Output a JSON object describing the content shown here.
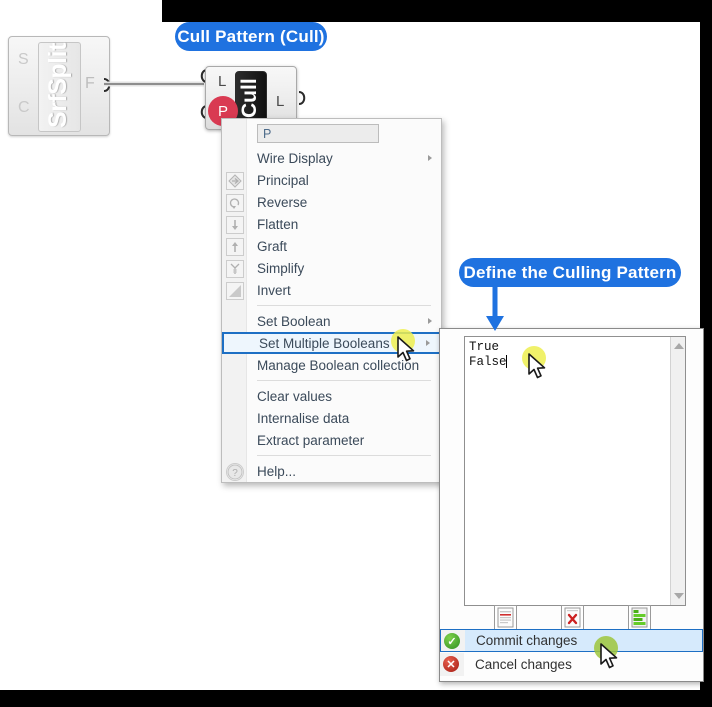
{
  "window": {
    "background": "#000000",
    "canvas_background": "#ffffff"
  },
  "callouts": [
    {
      "id": "cull-pattern",
      "text": "Cull Pattern (Cull)",
      "color": "#1f72e0"
    },
    {
      "id": "define-pattern",
      "text": "Define the Culling Pattern",
      "color": "#1f72e0"
    }
  ],
  "components": {
    "srfsplit": {
      "name": "SrfSplit",
      "inputs": [
        "S",
        "C"
      ],
      "outputs": [
        "F"
      ]
    },
    "cull": {
      "name": "Cull",
      "inputs": [
        "L",
        "P"
      ],
      "outputs": [
        "L"
      ],
      "highlighted_input": "P",
      "highlight_color": "#d93a52"
    }
  },
  "context_menu": {
    "name_field_value": "P",
    "items": [
      {
        "label": "Wire Display",
        "icon": "",
        "submenu": true,
        "selected": false,
        "separator_after": false
      },
      {
        "label": "Principal",
        "icon": "principal-icon",
        "submenu": false,
        "selected": false,
        "separator_after": false
      },
      {
        "label": "Reverse",
        "icon": "reverse-icon",
        "submenu": false,
        "selected": false,
        "separator_after": false
      },
      {
        "label": "Flatten",
        "icon": "flatten-icon",
        "submenu": false,
        "selected": false,
        "separator_after": false
      },
      {
        "label": "Graft",
        "icon": "graft-icon",
        "submenu": false,
        "selected": false,
        "separator_after": false
      },
      {
        "label": "Simplify",
        "icon": "simplify-icon",
        "submenu": false,
        "selected": false,
        "separator_after": false
      },
      {
        "label": "Invert",
        "icon": "invert-icon",
        "submenu": false,
        "selected": false,
        "separator_after": true
      },
      {
        "label": "Set Boolean",
        "icon": "",
        "submenu": true,
        "selected": false,
        "separator_after": false
      },
      {
        "label": "Set Multiple Booleans",
        "icon": "",
        "submenu": true,
        "selected": true,
        "separator_after": false
      },
      {
        "label": "Manage Boolean collection",
        "icon": "",
        "submenu": false,
        "selected": false,
        "separator_after": true
      },
      {
        "label": "Clear values",
        "icon": "",
        "submenu": false,
        "selected": false,
        "separator_after": false
      },
      {
        "label": "Internalise data",
        "icon": "",
        "submenu": false,
        "selected": false,
        "separator_after": false
      },
      {
        "label": "Extract parameter",
        "icon": "",
        "submenu": false,
        "selected": false,
        "separator_after": true
      },
      {
        "label": "Help...",
        "icon": "help-icon",
        "submenu": false,
        "selected": false,
        "separator_after": false
      }
    ]
  },
  "editor": {
    "textarea_value": "True\nFalse",
    "lines": [
      "True",
      "False"
    ],
    "toolbar": [
      {
        "id": "load-from-file",
        "icon": "document-red-line-icon"
      },
      {
        "id": "delete-contents",
        "icon": "document-red-x-icon"
      },
      {
        "id": "apply-formatting",
        "icon": "document-green-lines-icon"
      }
    ],
    "scrollbar": {
      "up": "scroll-up-arrow-icon",
      "down": "scroll-down-arrow-icon"
    },
    "commit": {
      "label": "Commit changes",
      "icon": "green-check-icon",
      "selected": true
    },
    "cancel": {
      "label": "Cancel changes",
      "icon": "red-x-icon",
      "selected": false
    }
  }
}
